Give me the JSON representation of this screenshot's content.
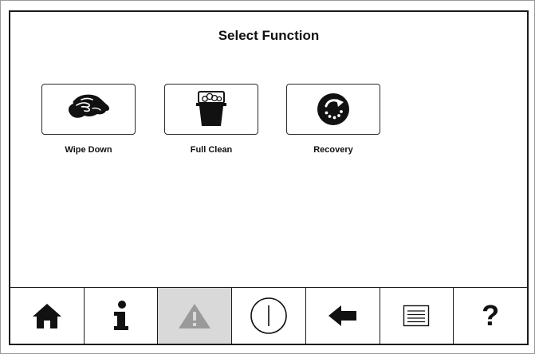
{
  "title": "Select Function",
  "functions": [
    {
      "label": "Wipe Down",
      "icon": "wipe-down-icon"
    },
    {
      "label": "Full Clean",
      "icon": "full-clean-bucket-icon"
    },
    {
      "label": "Recovery",
      "icon": "recovery-icon"
    }
  ],
  "nav": {
    "help_label": "?",
    "items": [
      {
        "icon": "home-icon",
        "enabled": true
      },
      {
        "icon": "info-icon",
        "enabled": true
      },
      {
        "icon": "warning-icon",
        "enabled": false
      },
      {
        "icon": "power-icon",
        "enabled": true
      },
      {
        "icon": "back-arrow-icon",
        "enabled": true
      },
      {
        "icon": "menu-list-icon",
        "enabled": true
      },
      {
        "icon": "help-icon",
        "enabled": true
      }
    ]
  },
  "colors": {
    "foreground": "#111111",
    "disabled_background": "#d9d9d9",
    "disabled_icon": "#9a9a9a"
  }
}
